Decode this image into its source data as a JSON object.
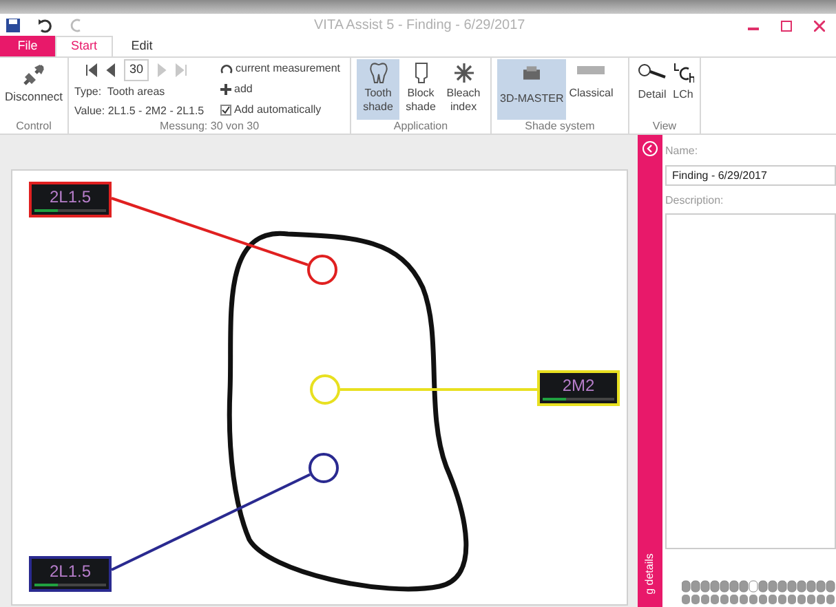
{
  "window": {
    "title": "VITA Assist 5 - Finding - 6/29/2017"
  },
  "tabs": [
    {
      "label": "File",
      "kind": "file",
      "selected": false
    },
    {
      "label": "Start",
      "kind": "tab",
      "selected": true
    },
    {
      "label": "Edit",
      "kind": "tab",
      "selected": false
    }
  ],
  "ribbon": {
    "control": {
      "label": "Control",
      "disconnect": "Disconnect"
    },
    "measurement": {
      "label": "Messung: 30 von 30",
      "number": "30",
      "type": "Type:  Tooth areas",
      "value": "Value: 2L1.5 - 2M2 - 2L1.5",
      "current": "current measurement",
      "add": "add",
      "auto": {
        "label": "Add automatically",
        "checked": true
      },
      "nav": [
        {
          "kind": "first",
          "disabled": false
        },
        {
          "kind": "prev",
          "disabled": false
        },
        {
          "kind": "next",
          "disabled": true
        },
        {
          "kind": "last",
          "disabled": true
        }
      ]
    },
    "application": {
      "label": "Application",
      "buttons": [
        {
          "line1": "Tooth",
          "line2": "shade",
          "kind": "tooth",
          "selected": true
        },
        {
          "line1": "Block",
          "line2": "shade",
          "kind": "block",
          "selected": false
        },
        {
          "line1": "Bleach",
          "line2": "index",
          "kind": "bleach",
          "selected": false
        }
      ]
    },
    "shade_system": {
      "label": "Shade system",
      "buttons": [
        {
          "label": "3D-MASTER",
          "kind": "master",
          "selected": true
        },
        {
          "label": "Classical",
          "kind": "classical",
          "selected": false
        }
      ]
    },
    "view": {
      "label": "View",
      "buttons": [
        {
          "label": "Detail",
          "kind": "detail"
        },
        {
          "label": "LCh",
          "kind": "lch"
        }
      ]
    }
  },
  "canvas": {
    "areas": [
      {
        "shade": "2L1.5",
        "color": "#e02020",
        "level": 0.33
      },
      {
        "shade": "2M2",
        "color": "#e8e020",
        "level": 0.33
      },
      {
        "shade": "2L1.5",
        "color": "#2a2a90",
        "level": 0.33
      }
    ]
  },
  "details": {
    "tab": "g details",
    "name_label": "Name:",
    "name_value": "Finding - 6/29/2017",
    "description_label": "Description:"
  }
}
